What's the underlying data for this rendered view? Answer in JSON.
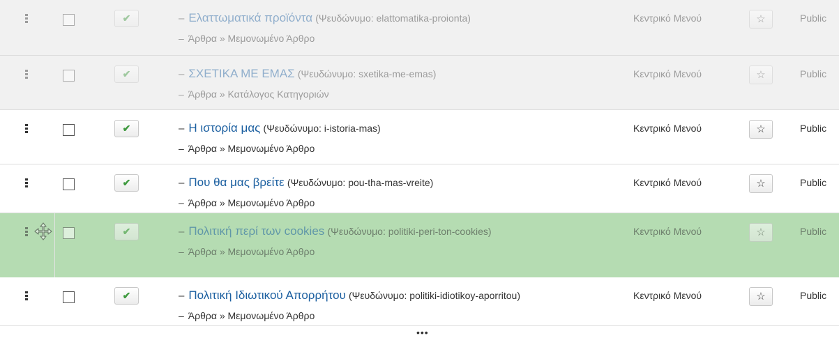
{
  "rows": [
    {
      "title": "Ελαττωματικά προϊόντα",
      "alias": "(Ψευδώνυμο: elattomatika-proionta)",
      "type": "Άρθρα » Μεμονωμένο Άρθρο",
      "menu": "Κεντρικό Μενού",
      "access": "Public",
      "state": "faded"
    },
    {
      "title": "ΣΧΕΤΙΚΑ ΜΕ ΕΜΑΣ",
      "alias": "(Ψευδώνυμο: sxetika-me-emas)",
      "type": "Άρθρα » Κατάλογος Κατηγοριών",
      "menu": "Κεντρικό Μενού",
      "access": "Public",
      "state": "faded"
    },
    {
      "title": "Η ιστορία μας",
      "alias": "(Ψευδώνυμο: i-istoria-mas)",
      "type": "Άρθρα » Μεμονωμένο Άρθρο",
      "menu": "Κεντρικό Μενού",
      "access": "Public",
      "state": "normal"
    },
    {
      "title": "Που θα μας βρείτε",
      "alias": "(Ψευδώνυμο: pou-tha-mas-vreite)",
      "type": "Άρθρα » Μεμονωμένο Άρθρο",
      "menu": "Κεντρικό Μενού",
      "access": "Public",
      "state": "normal"
    },
    {
      "title": "Πολιτική περί των cookies",
      "alias": "(Ψευδώνυμο: politiki-peri-ton-cookies)",
      "type": "Άρθρα » Μεμονωμένο Άρθρο",
      "menu": "Κεντρικό Μενού",
      "access": "Public",
      "state": "dragging"
    },
    {
      "title": "Πολιτική Ιδιωτικού Απορρήτου",
      "alias": "(Ψευδώνυμο: politiki-idiotikoy-aporritou)",
      "type": "Άρθρα » Μεμονωμένο Άρθρο",
      "menu": "Κεντρικό Μενού",
      "access": "Public",
      "state": "normal"
    }
  ],
  "glyphs": {
    "dash": "–",
    "check": "✔",
    "star": "☆",
    "more": "•••"
  },
  "icons": {
    "drag_handle": "drag-handle-icon",
    "move_cursor": "move-cursor-icon",
    "publish": "checkmark-icon",
    "home": "star-icon"
  },
  "colors": {
    "title_link": "#1b5fa0",
    "publish_check": "#3f9a3f",
    "drag_highlight": "#b5dcb2",
    "faded_row": "#f1f1f1"
  }
}
